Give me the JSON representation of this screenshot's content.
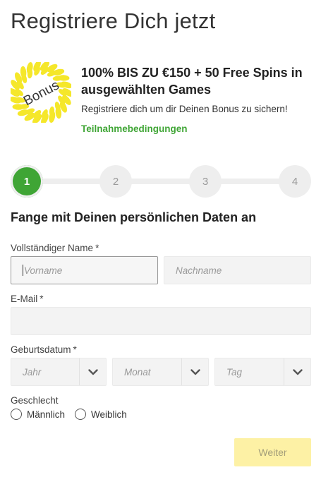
{
  "page": {
    "title": "Registriere Dich jetzt"
  },
  "bonus": {
    "badge_text": "Bonus",
    "headline": "100% BIS ZU €150 + 50 Free Spins in ausgewählten Games",
    "subtitle": "Registriere dich um dir Deinen Bonus zu sichern!",
    "terms_link": "Teilnahmebedingungen",
    "badge_color": "#f5e72a"
  },
  "stepper": {
    "steps": [
      "1",
      "2",
      "3",
      "4"
    ],
    "active_step": 1,
    "active_color": "#3fa535"
  },
  "form": {
    "section_title": "Fange mit Deinen persönlichen Daten an",
    "fullname": {
      "label": "Vollständiger Name",
      "required_mark": "*",
      "first_placeholder": "Vorname",
      "last_placeholder": "Nachname"
    },
    "email": {
      "label": "E-Mail",
      "required_mark": "*",
      "value": ""
    },
    "birthdate": {
      "label": "Geburtsdatum",
      "required_mark": "*",
      "year": "Jahr",
      "month": "Monat",
      "day": "Tag"
    },
    "gender": {
      "label": "Geschlecht",
      "options": [
        "Männlich",
        "Weiblich"
      ]
    },
    "next_button": "Weiter"
  }
}
